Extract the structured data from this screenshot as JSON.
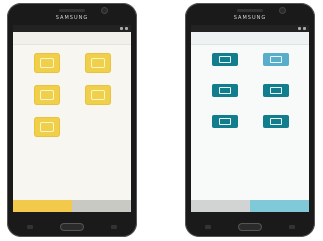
{
  "left_phone": {
    "brand": "SAMSUNG",
    "header": {
      "left": "",
      "right": ""
    },
    "tiles": [
      "yellow",
      "yellow",
      "yellow",
      "yellow",
      "yellow",
      "empty"
    ],
    "bottom": {
      "a": "",
      "b": ""
    }
  },
  "right_phone": {
    "brand": "SAMSUNG",
    "header": {
      "left": "",
      "right": ""
    },
    "tiles": [
      "teal",
      "teal-light",
      "teal",
      "teal",
      "teal",
      "teal"
    ],
    "bottom": {
      "a": "",
      "b": ""
    }
  },
  "colors": {
    "phone_body": "#1a1a1a",
    "yellow_accent": "#f0cf4a",
    "teal_accent": "#127d8c",
    "light_teal_accent": "#58aeca"
  }
}
